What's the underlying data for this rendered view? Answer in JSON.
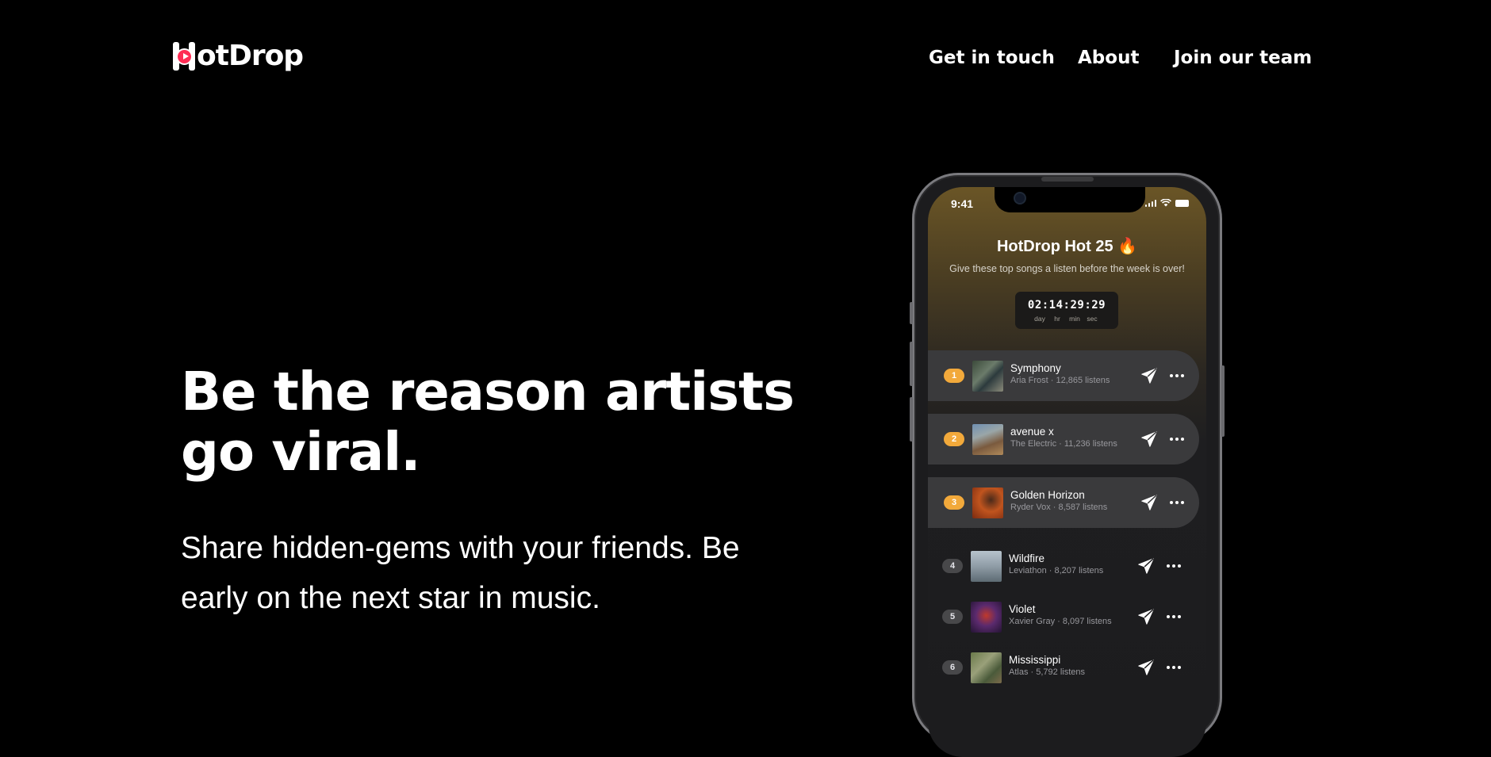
{
  "brand": {
    "logo_text": "otDrop",
    "logo_full": "HotDrop",
    "accent": "#ff2d55"
  },
  "nav": [
    {
      "label": "Get in touch"
    },
    {
      "label": "About"
    },
    {
      "label": "Join our team"
    }
  ],
  "hero": {
    "title": "Be the reason artists go viral.",
    "subtitle": "Share hidden-gems with your friends. Be early on the next star in music."
  },
  "phone": {
    "status_time": "9:41",
    "title": "HotDrop Hot 25 🔥",
    "subtitle": "Give these top songs a listen before the week is over!",
    "countdown": {
      "value": "02:14:29:29",
      "labels": [
        "day",
        "hr",
        "min",
        "sec"
      ]
    },
    "rank_color": "#f2a93b",
    "tracks": [
      {
        "rank": "1",
        "title": "Symphony",
        "artist_line": "Aria Frost · 12,865 listens"
      },
      {
        "rank": "2",
        "title": "avenue x",
        "artist_line": "The Electric  · 11,236 listens"
      },
      {
        "rank": "3",
        "title": "Golden Horizon",
        "artist_line": "Ryder Vox · 8,587 listens"
      },
      {
        "rank": "4",
        "title": "Wildfire",
        "artist_line": "Leviathon · 8,207 listens"
      },
      {
        "rank": "5",
        "title": "Violet",
        "artist_line": "Xavier Gray · 8,097 listens"
      },
      {
        "rank": "6",
        "title": "Mississippi",
        "artist_line": "Atlas · 5,792 listens"
      }
    ]
  }
}
